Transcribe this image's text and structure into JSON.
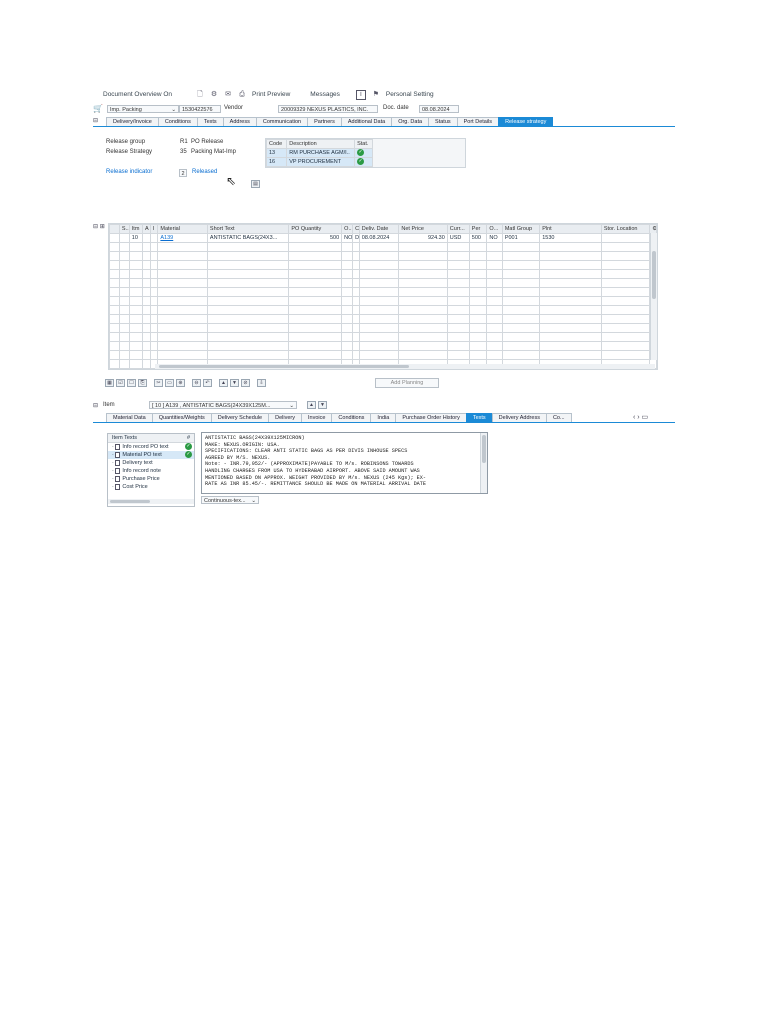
{
  "toolbar": {
    "doc_overview": "Document Overview On",
    "print_preview": "Print Preview",
    "messages": "Messages",
    "personal_setting": "Personal Setting"
  },
  "header": {
    "po_type": "Imp. Packing",
    "po_number": "1530422576",
    "vendor_label": "Vendor",
    "vendor_value": "20009329 NEXUS PLASTICS, INC.",
    "doc_date_label": "Doc. date",
    "doc_date_value": "08.08.2024"
  },
  "header_tabs": [
    "Delivery/Invoice",
    "Conditions",
    "Texts",
    "Address",
    "Communication",
    "Partners",
    "Additional Data",
    "Org. Data",
    "Status",
    "Port Details",
    "Release strategy"
  ],
  "release": {
    "group_label": "Release group",
    "group_code": "R1",
    "group_value": "PO Release",
    "strategy_label": "Release Strategy",
    "strategy_code": "35",
    "strategy_value": "Packing Mat-Imp",
    "indicator_label": "Release indicator",
    "indicator_code": "2",
    "indicator_value": "Released",
    "table_headers": [
      "Code",
      "Description",
      "Stat."
    ],
    "rows": [
      {
        "code": "13",
        "description": "RM PURCHASE AGM/I..",
        "status": "released"
      },
      {
        "code": "16",
        "description": "VP PROCUREMENT",
        "status": "released"
      }
    ]
  },
  "items": {
    "headers": [
      "S..",
      "Itm",
      "A",
      "I",
      "Material",
      "Short Text",
      "PO Quantity",
      "O...",
      "C",
      "Deliv. Date",
      "Net Price",
      "Curr...",
      "Per",
      "O...",
      "Matl Group",
      "Plnt",
      "Stor. Location"
    ],
    "row": {
      "itm": "10",
      "material": "A139",
      "short_text": "ANTISTATIC BAGS(24X3...",
      "qty": "500",
      "oun": "NO",
      "c": "D",
      "deliv_date": "08.08.2024",
      "net_price": "924.30",
      "curr": "USD",
      "per": "500",
      "opu": "NO",
      "matl_group": "P001",
      "plant": "1530",
      "stor_loc": ""
    },
    "add_planning": "Add Planning"
  },
  "item_detail": {
    "item_label": "Item",
    "item_value": "[ 10 ] A139 , ANTISTATIC BAGS(24X39X125M...",
    "tabs": [
      "Material Data",
      "Quantities/Weights",
      "Delivery Schedule",
      "Delivery",
      "Invoice",
      "Conditions",
      "India",
      "Purchase Order History",
      "Texts",
      "Delivery Address",
      "Co..."
    ],
    "text_list_header": "Item Texts",
    "text_list": [
      {
        "label": "Info record PO text",
        "checked": true
      },
      {
        "label": "Material PO text",
        "checked": true
      },
      {
        "label": "Delivery text",
        "checked": false
      },
      {
        "label": "Info record note",
        "checked": false
      },
      {
        "label": "Purchase Price",
        "checked": false
      },
      {
        "label": "Cost Price",
        "checked": false
      }
    ],
    "editor_lines": [
      "ANTISTATIC BAGS(24X39X125MICRON)",
      "MAKE: NEXUS.ORIGIN: USA.",
      "SPECIFICATIONS: CLEAR ANTI STATIC BAGS AS PER DIVIS INHOUSE SPECS",
      "AGREED BY M/S. NEXUS.",
      "Note: - INR.79,952/- (APPROXIMATE)PAYABLE TO M/s. ROBINSONS TOWARDS",
      "HANDLING CHARGES FROM USA TO HYDERABAD AIRPORT. ABOVE SAID AMOUNT WAS",
      "MENTIONED BASED ON APPROX. WEIGHT PROVIDED BY M/s. NEXUS (245 Kgs); EX-",
      "RATE AS INR 85.45/-. REMITTANCE SHOULD BE MADE ON MATERIAL ARRIVAL DATE"
    ],
    "format": "Continuous-tex..."
  },
  "colors": {
    "accent": "#1b8ad6",
    "ok": "#2b9a44"
  }
}
